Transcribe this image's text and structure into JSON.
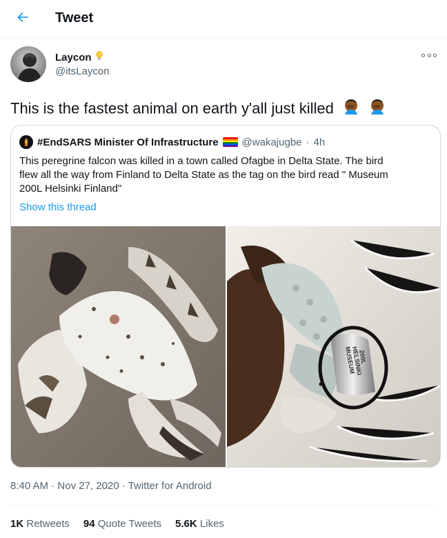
{
  "header": {
    "title": "Tweet",
    "back_icon": "arrow-left-icon"
  },
  "author": {
    "name": "Laycon",
    "badge_icon": "lightbulb-icon",
    "handle": "@itsLaycon"
  },
  "tweet": {
    "text": "This is the fastest animal on earth y'all just killed",
    "emojis": [
      "face-palm-emoji",
      "face-palm-emoji"
    ]
  },
  "quote": {
    "name": "#EndSARS Minister Of Infrastructure",
    "handle": "@wakajugbe",
    "separator": "·",
    "time": "4h",
    "text_lines": [
      "This peregrine falcon was killed in a town called Ofagbe in Delta State. The bird",
      "flew all the way from Finland to Delta State as the tag on the bird read \" Museum",
      "200L Helsinki Finland\""
    ],
    "show_thread": "Show this thread"
  },
  "meta": {
    "time": "8:40 AM",
    "sep1": " · ",
    "date": "Nov 27, 2020",
    "sep2": " · ",
    "source": "Twitter for Android"
  },
  "stats": {
    "retweets": {
      "count": "1K",
      "label": "Retweets"
    },
    "quotes": {
      "count": "94",
      "label": "Quote Tweets"
    },
    "likes": {
      "count": "5.6K",
      "label": "Likes"
    }
  },
  "colors": {
    "accent": "#1d9bf0",
    "secondary_text": "#536471",
    "border": "#cfd9de"
  }
}
